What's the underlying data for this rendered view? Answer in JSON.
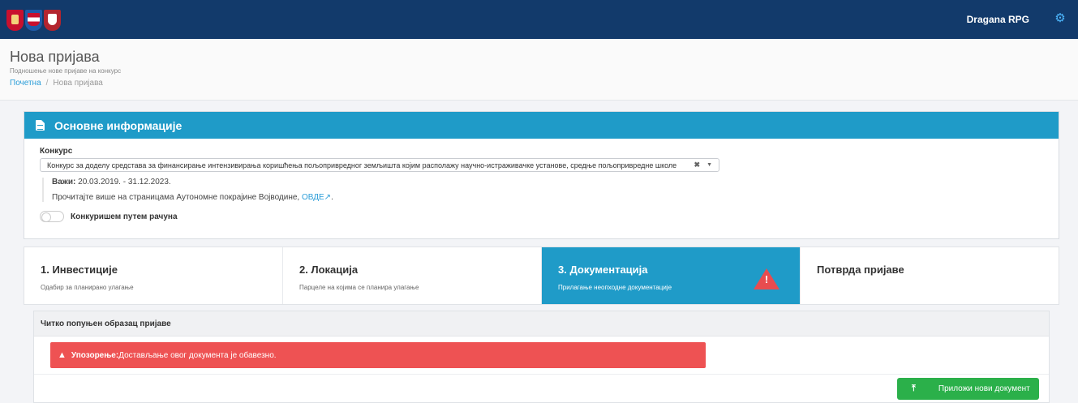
{
  "topbar": {
    "user_name": "Dragana RPG",
    "logos": [
      "serbia-coat-of-arms",
      "vojvodina-coat-of-arms",
      "novi-sad-coat-of-arms"
    ],
    "settings_icon": "gear-icon"
  },
  "page": {
    "title": "Нова пријава",
    "subtitle": "Подношење нове пријаве на конкурс",
    "breadcrumb": {
      "home": "Почетна",
      "separator": "/",
      "current": "Нова пријава"
    }
  },
  "info": {
    "header_title": "Основне информације",
    "konkurs_label": "Конкурс",
    "konkurs_value": "Конкурс за доделу средстава за финансирање интензивирања коришћења пољопривредног земљишта којим располажу научно-истраживачке установе, средње пољопривредне школе",
    "valid_label": "Важи:",
    "valid_value": " 20.03.2019. - 31.12.2023.",
    "read_more_text": "Прочитајте више на страницама Аутономне покрајине Војводине, ",
    "read_more_link": "ОВДЕ",
    "read_more_end": ".",
    "toggle_label": "Конкуришем путем рачуна",
    "toggle_on": false
  },
  "steps": [
    {
      "title": "1. Инвестиције",
      "subtitle": "Одабир за планирано улагање",
      "active": false
    },
    {
      "title": "2. Локација",
      "subtitle": "Парцеле на којима се планира улагање",
      "active": false
    },
    {
      "title": "3. Документација",
      "subtitle": "Прилагање неопходне документације",
      "active": true,
      "warning": true
    },
    {
      "title": "Потврда пријаве",
      "subtitle": "",
      "active": false
    }
  ],
  "documents": {
    "section_title": "Читко попуњен образац пријаве",
    "alert_strong": "Упозорење:",
    "alert_text": " Достављање овог документа је обавезно.",
    "attach_button": "Приложи нови документ"
  },
  "colors": {
    "topbar": "#123a6b",
    "accent": "#1f9bc8",
    "alert": "#ee5253",
    "success": "#2bb04a",
    "link": "#2a9dd8"
  }
}
